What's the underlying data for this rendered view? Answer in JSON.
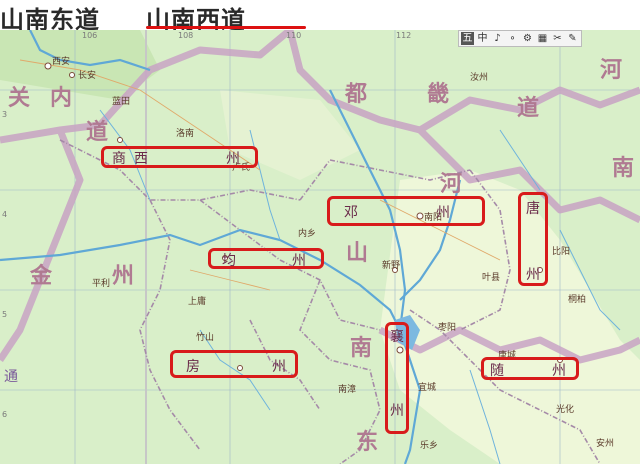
{
  "title_left": "山南东道",
  "title_right": "山南西道",
  "toolbar": {
    "buttons": [
      {
        "label": "五"
      },
      {
        "label": "中"
      },
      {
        "label": "♪"
      },
      {
        "label": "∘"
      },
      {
        "label": "⚙"
      },
      {
        "label": "▦"
      },
      {
        "label": "✂"
      },
      {
        "label": "✎"
      }
    ]
  },
  "regions": [
    {
      "label": "关"
    },
    {
      "label": "内"
    },
    {
      "label": "道"
    },
    {
      "label": "都"
    },
    {
      "label": "畿"
    },
    {
      "label": "道"
    },
    {
      "label": "河"
    },
    {
      "label": "南"
    },
    {
      "label": "河"
    },
    {
      "label": "山"
    },
    {
      "label": "南"
    },
    {
      "label": "东"
    },
    {
      "label": "金"
    },
    {
      "label": "州"
    },
    {
      "label": "通"
    }
  ],
  "prefectures": [
    {
      "id": "shang",
      "chars": [
        "商",
        "西",
        "州"
      ]
    },
    {
      "id": "deng",
      "chars": [
        "邓",
        "州"
      ]
    },
    {
      "id": "jun",
      "chars": [
        "均",
        "州"
      ]
    },
    {
      "id": "tang",
      "chars": [
        "唐",
        "州"
      ]
    },
    {
      "id": "fang",
      "chars": [
        "房",
        "州"
      ]
    },
    {
      "id": "xiang",
      "chars": [
        "襄",
        "州"
      ]
    },
    {
      "id": "sui",
      "chars": [
        "随",
        "州"
      ]
    }
  ],
  "cities": [
    {
      "label": "西安"
    },
    {
      "label": "长安"
    },
    {
      "label": "蓝田"
    },
    {
      "label": "洛南"
    },
    {
      "label": "卢氏"
    },
    {
      "label": "内乡"
    },
    {
      "label": "南阳"
    },
    {
      "label": "新野"
    },
    {
      "label": "上庸"
    },
    {
      "label": "竹山"
    },
    {
      "label": "平利"
    },
    {
      "label": "唐城"
    },
    {
      "label": "枣阳"
    },
    {
      "label": "乐乡"
    },
    {
      "label": "南漳"
    },
    {
      "label": "宜城"
    },
    {
      "label": "汝州"
    },
    {
      "label": "叶县"
    },
    {
      "label": "比阳"
    },
    {
      "label": "桐柏"
    },
    {
      "label": "光化"
    },
    {
      "label": "安州"
    }
  ],
  "grid": {
    "top": [
      "106",
      "108",
      "110",
      "112",
      "114",
      "116"
    ],
    "side": [
      "3",
      "4",
      "5",
      "6",
      "7",
      "8"
    ]
  }
}
